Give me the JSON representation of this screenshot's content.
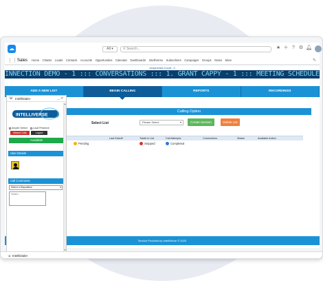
{
  "global_header": {
    "scope_label": "All",
    "search_placeholder": "Search..."
  },
  "nav": {
    "app_name": "Sales",
    "items": [
      "Home",
      "Chatter",
      "Leads",
      "Contacts",
      "Accounts",
      "Opportunities",
      "Calendar",
      "Dashboards",
      "IntelliVerse",
      "Subscribers",
      "Campaigns",
      "Groups",
      "Notes",
      "More"
    ]
  },
  "content": {
    "unsynced_label": "Unsynched Count : 0",
    "ticker_text": "INNECTION DEMO - 1 ::: CONVERSATIONS ::: 1. GRANT CAPPY - 1 ::: MEETING SCHEDULED :::",
    "tabs": [
      "ADD A NEW LIST",
      "BEGIN CALLING",
      "REPORTS",
      "RECORDINGS"
    ]
  },
  "calling_option": {
    "header": "Calling Option",
    "select_list_label": "Select List",
    "select_value": "Please Select",
    "create_button": "Create Session",
    "delete_button": "Delete List",
    "columns": [
      "Last Kickoff",
      "Total# in List",
      "Call Attempts",
      "Connections",
      "Status",
      "Available Action"
    ],
    "legend": [
      {
        "label": "Pending",
        "color": "#f5b400"
      },
      {
        "label": "Stopped",
        "color": "#d9322c"
      },
      {
        "label": "Completed",
        "color": "#2b79d8"
      }
    ]
  },
  "footer_text": "Service Provided by IntelliVerse © 2020",
  "dialer": {
    "title": "IntelliDialer",
    "logo_text": "INTELLIVERSE",
    "check1": "Answer Detect",
    "check2": "Local Presence",
    "missed_calls": "Missed Calls",
    "logout": "Logout",
    "available": "Available",
    "user_details": "User Details",
    "call_comments": "Call Comments",
    "disposition": "Select a Disposition",
    "notes_placeholder": "Notes..."
  },
  "utility_bar": {
    "item": "IntelliDialer"
  },
  "colors": {
    "brand_blue": "#1b92d6",
    "ticker_bg": "#0b3e6e",
    "available_green": "#1ea94a"
  }
}
